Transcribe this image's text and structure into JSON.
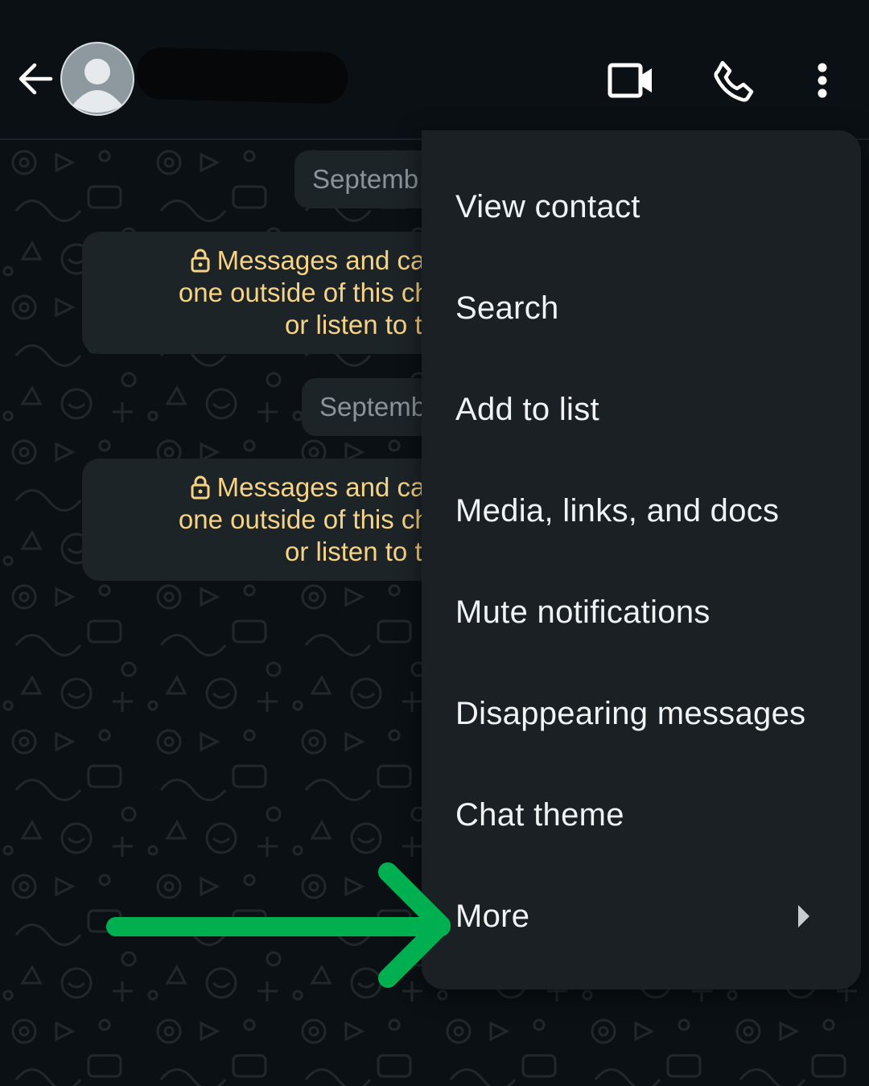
{
  "header": {
    "back_icon": "arrow-left-icon",
    "avatar_icon": "default-avatar-icon",
    "video_call_icon": "video-camera-icon",
    "voice_call_icon": "phone-icon",
    "more_options_icon": "vertical-dots-icon"
  },
  "chat": {
    "date_1": "Septemb",
    "notice_1": "Messages and calls ar one outside of this chat, n or listen to them.",
    "notice_1_lines": [
      "Messages and calls ar",
      "one outside of this chat, n",
      "or listen to them."
    ],
    "date_2": "Septemb",
    "notice_2_lines": [
      "Messages and calls ar",
      "one outside of this chat, n",
      "or listen to them."
    ]
  },
  "menu": {
    "items": [
      {
        "label": "View contact"
      },
      {
        "label": "Search"
      },
      {
        "label": "Add to list"
      },
      {
        "label": "Media, links, and docs"
      },
      {
        "label": "Mute notifications"
      },
      {
        "label": "Disappearing messages"
      },
      {
        "label": "Chat theme"
      },
      {
        "label": "More"
      }
    ]
  },
  "colors": {
    "background": "#0b1014",
    "menu_background": "#1a2024",
    "notice_text": "#f7d385",
    "annotation_arrow": "#00b050"
  }
}
